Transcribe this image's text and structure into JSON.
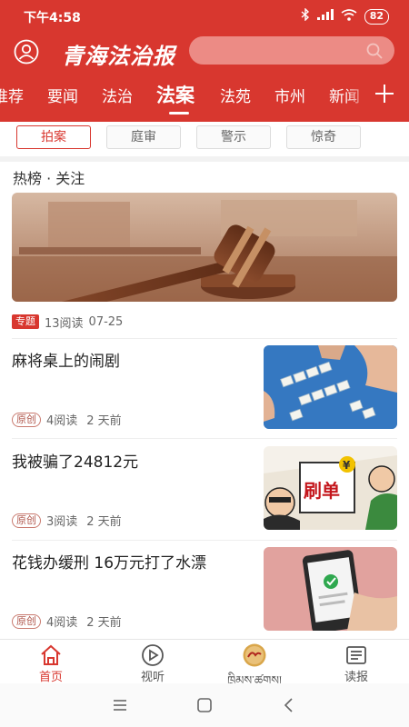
{
  "status": {
    "time": "下午4:58",
    "battery": "82"
  },
  "header": {
    "logo": "青海法治报",
    "search_placeholder": ""
  },
  "channels": [
    {
      "label": "推荐"
    },
    {
      "label": "要闻"
    },
    {
      "label": "法治"
    },
    {
      "label": "法案"
    },
    {
      "label": "法苑"
    },
    {
      "label": "市州"
    },
    {
      "label": "新闻"
    }
  ],
  "subtabs": [
    {
      "label": "拍案"
    },
    {
      "label": "庭审"
    },
    {
      "label": "警示"
    },
    {
      "label": "惊奇"
    }
  ],
  "hot": {
    "title": "热榜 · 关注",
    "tag": "专题",
    "reads": "13阅读",
    "date": "07-25"
  },
  "articles": [
    {
      "title": "麻将桌上的闹剧",
      "tag": "原创",
      "reads": "4阅读",
      "time": "2 天前",
      "thumb": "mahjong-image"
    },
    {
      "title": "我被骗了24812元",
      "tag": "原创",
      "reads": "3阅读",
      "time": "2 天前",
      "thumb": "fraud-cartoon-image"
    },
    {
      "title": "花钱办缓刑 16万元打了水漂",
      "tag": "原创",
      "reads": "4阅读",
      "time": "2 天前",
      "thumb": "phone-payment-image"
    }
  ],
  "bottom_nav": [
    {
      "label": "首页",
      "icon": "home-icon"
    },
    {
      "label": "视听",
      "icon": "play-icon"
    },
    {
      "label": "ཁྲིམས་ཚགས།",
      "icon": "tibetan-logo-icon"
    },
    {
      "label": "读报",
      "icon": "newspaper-icon"
    }
  ],
  "thumb_texts": {
    "fraud_sign": "刷单"
  },
  "colors": {
    "brand_red": "#d8372f"
  }
}
